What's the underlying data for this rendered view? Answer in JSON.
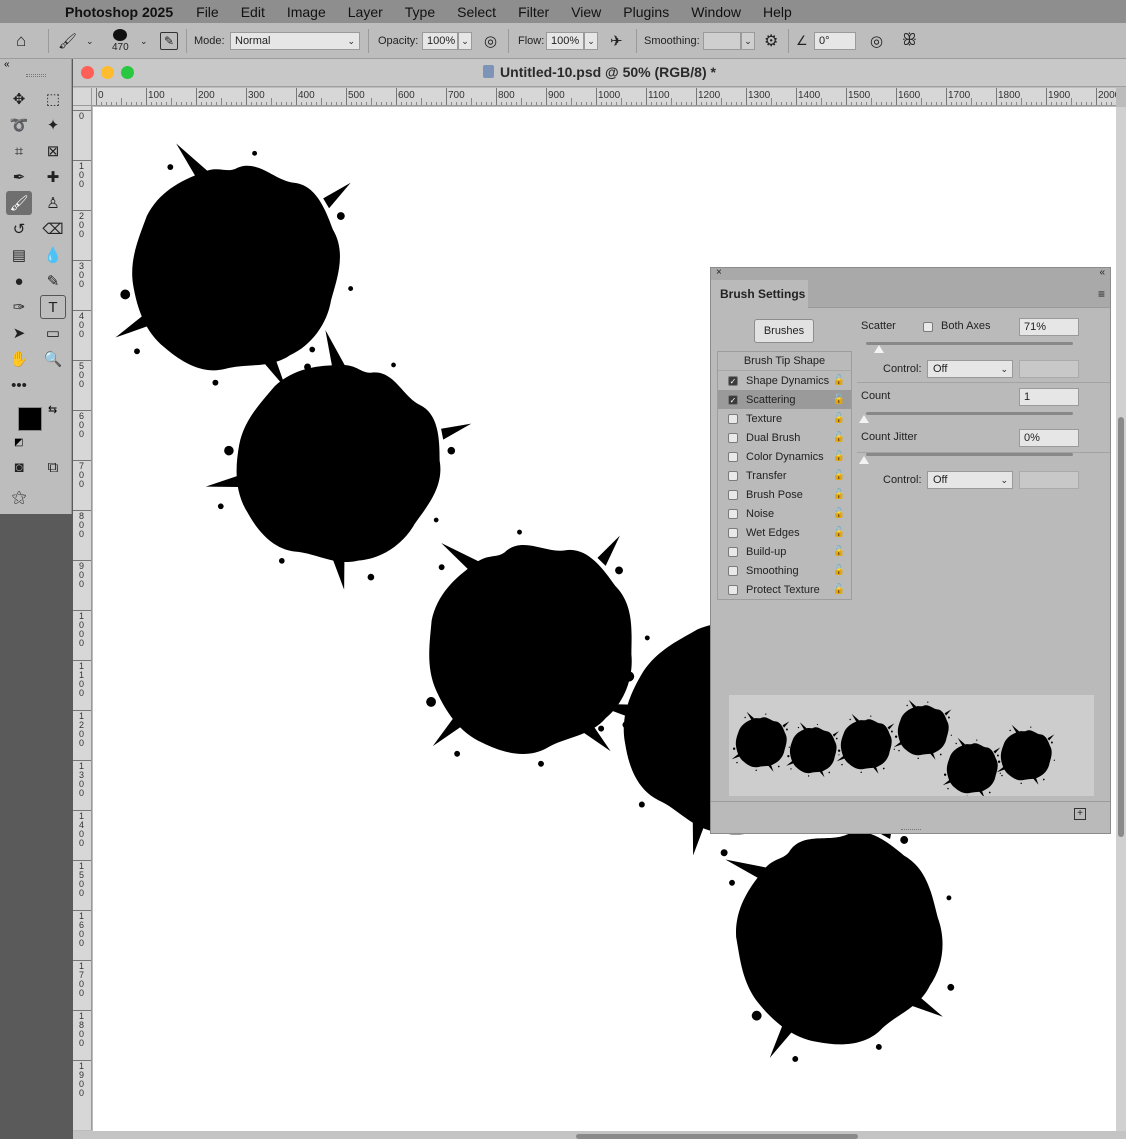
{
  "menubar": {
    "app_name": "Photoshop 2025",
    "items": [
      "File",
      "Edit",
      "Image",
      "Layer",
      "Type",
      "Select",
      "Filter",
      "View",
      "Plugins",
      "Window",
      "Help"
    ]
  },
  "options": {
    "brush_size": "470",
    "mode_label": "Mode:",
    "mode_value": "Normal",
    "opacity_label": "Opacity:",
    "opacity_value": "100%",
    "flow_label": "Flow:",
    "flow_value": "100%",
    "smoothing_label": "Smoothing:",
    "smoothing_value": "",
    "angle_value": "0°"
  },
  "document": {
    "title": "Untitled-10.psd @ 50% (RGB/8) *",
    "ruler_h": [
      "0",
      "100",
      "200",
      "300",
      "400",
      "500",
      "600",
      "700",
      "800",
      "900",
      "1000",
      "1100",
      "1200",
      "1300",
      "1400",
      "1500",
      "1600",
      "1700",
      "1800",
      "1900",
      "2000"
    ],
    "ruler_v": [
      "0",
      "100",
      "200",
      "300",
      "400",
      "500",
      "600",
      "700",
      "800",
      "900",
      "1000",
      "1100",
      "1200",
      "1300",
      "1400",
      "1500",
      "1600",
      "1700",
      "1800",
      "1900"
    ]
  },
  "brush_panel": {
    "tab_title": "Brush Settings",
    "brushes_button": "Brushes",
    "list_header": "Brush Tip Shape",
    "items": [
      {
        "label": "Shape Dynamics",
        "checked": true,
        "selected": false
      },
      {
        "label": "Scattering",
        "checked": true,
        "selected": true
      },
      {
        "label": "Texture",
        "checked": false,
        "selected": false
      },
      {
        "label": "Dual Brush",
        "checked": false,
        "selected": false
      },
      {
        "label": "Color Dynamics",
        "checked": false,
        "selected": false
      },
      {
        "label": "Transfer",
        "checked": false,
        "selected": false
      },
      {
        "label": "Brush Pose",
        "checked": false,
        "selected": false
      },
      {
        "label": "Noise",
        "checked": false,
        "selected": false
      },
      {
        "label": "Wet Edges",
        "checked": false,
        "selected": false
      },
      {
        "label": "Build-up",
        "checked": false,
        "selected": false
      },
      {
        "label": "Smoothing",
        "checked": false,
        "selected": false
      },
      {
        "label": "Protect Texture",
        "checked": false,
        "selected": false
      }
    ],
    "scatter_label": "Scatter",
    "both_axes_label": "Both Axes",
    "scatter_value": "71%",
    "control_label": "Control:",
    "control_value": "Off",
    "count_label": "Count",
    "count_value": "1",
    "count_jitter_label": "Count Jitter",
    "count_jitter_value": "0%",
    "control2_label": "Control:",
    "control2_value": "Off"
  },
  "colors": {
    "foreground": "#000000",
    "background": "#ffffff"
  }
}
